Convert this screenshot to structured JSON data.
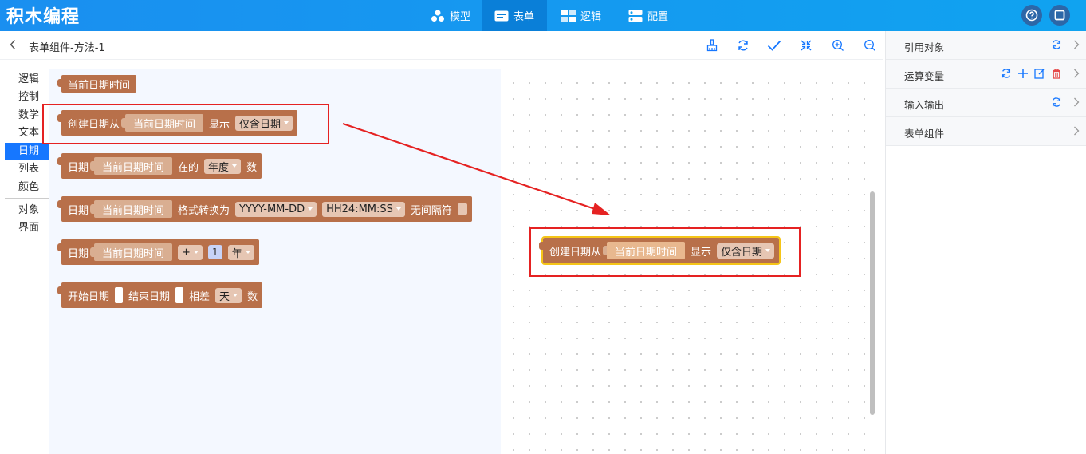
{
  "app": {
    "title": "积木编程"
  },
  "nav": {
    "tabs": [
      {
        "label": "模型",
        "icon": "model-icon"
      },
      {
        "label": "表单",
        "icon": "form-icon"
      },
      {
        "label": "逻辑",
        "icon": "logic-icon"
      },
      {
        "label": "配置",
        "icon": "config-icon"
      }
    ],
    "active": "表单"
  },
  "breadcrumb": {
    "title": "表单组件-方法-1"
  },
  "categories": {
    "items": [
      "逻辑",
      "控制",
      "数学",
      "文本",
      "日期",
      "列表",
      "颜色",
      "对象",
      "界面"
    ],
    "selected": "日期"
  },
  "flyout": {
    "block1": {
      "label": "当前日期时间"
    },
    "block2": {
      "lead": "创建日期从",
      "input": "当前日期时间",
      "mid": "显示",
      "option": "仅含日期"
    },
    "block3": {
      "lead": "日期",
      "input": "当前日期时间",
      "mid": "在的",
      "option": "年度",
      "tail": "数"
    },
    "block4": {
      "lead": "日期",
      "input": "当前日期时间",
      "mid": "格式转换为",
      "option1": "YYYY-MM-DD",
      "option2": "HH24:MM:SS",
      "tail": "无间隔符"
    },
    "block5": {
      "lead": "日期",
      "input": "当前日期时间",
      "op": "+",
      "value": "1",
      "unit": "年"
    },
    "block6": {
      "lead": "开始日期",
      "mid1": "结束日期",
      "mid2": "相差",
      "option": "天",
      "tail": "数"
    }
  },
  "workspace": {
    "block": {
      "lead": "创建日期从",
      "input": "当前日期时间",
      "mid": "显示",
      "option": "仅含日期"
    }
  },
  "right_panel": {
    "rows": [
      {
        "label": "引用对象"
      },
      {
        "label": "运算变量"
      },
      {
        "label": "输入输出"
      },
      {
        "label": "表单组件"
      }
    ]
  },
  "colors": {
    "block": "#b8704a",
    "highlight": "#e52222",
    "accent": "#1677ff"
  }
}
